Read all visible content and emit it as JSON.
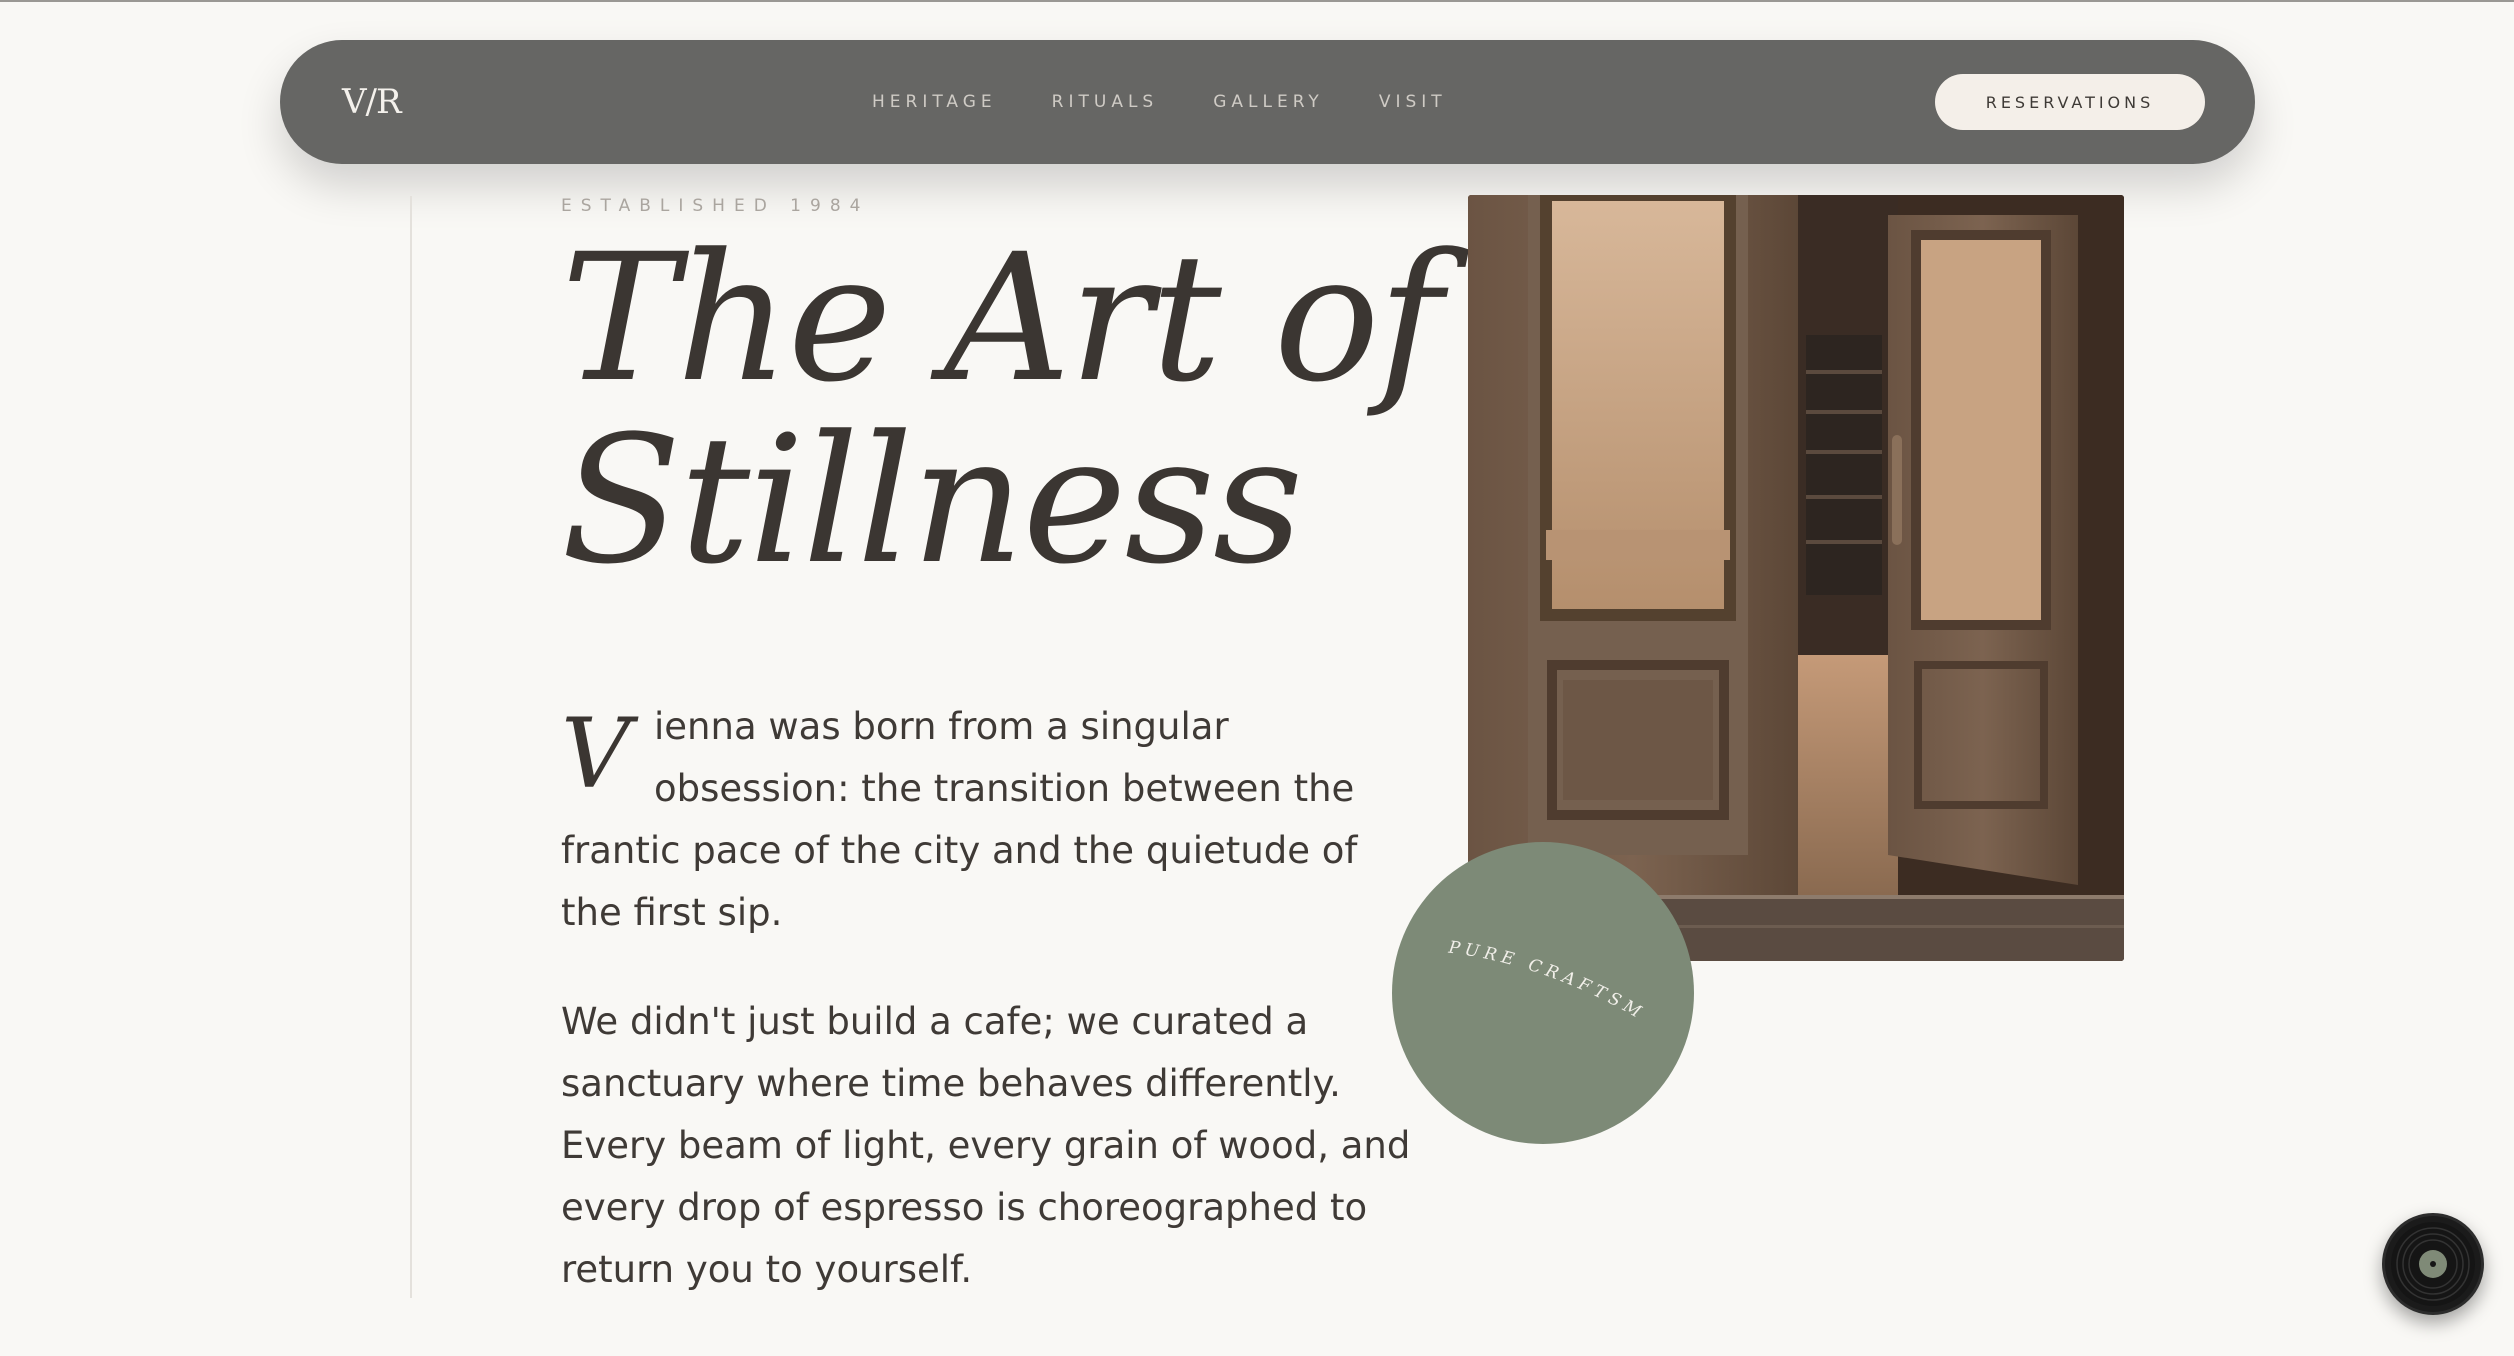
{
  "nav": {
    "logo": "V/R",
    "links": [
      "HERITAGE",
      "RITUALS",
      "GALLERY",
      "VISIT"
    ],
    "cta": "RESERVATIONS"
  },
  "hero": {
    "eyebrow": "ESTABLISHED 1984",
    "title_lines": [
      "The Art of",
      "Stillness"
    ],
    "dropcap": "V",
    "lead_lines": [
      "ienna was born from a singular",
      "obsession: the transition between the",
      "frantic pace of the city and the quietude of",
      "the first sip."
    ],
    "body_lines": [
      "We didn't just build a cafe; we curated a",
      "sanctuary where time behaves differently.",
      "Every beam of light, every grain of wood, and",
      "every drop of espresso is choreographed to",
      "return you to yourself."
    ]
  },
  "badge": {
    "text": "PURE CRAFTSMANSHIP"
  },
  "image": {
    "alt": "Cafe entrance with open wooden doors"
  },
  "colors": {
    "background": "#f9f8f5",
    "nav": "#666664",
    "badge": "#7d8a77",
    "text": "#3b3632"
  },
  "icons": {
    "music": "vinyl-record-icon"
  }
}
